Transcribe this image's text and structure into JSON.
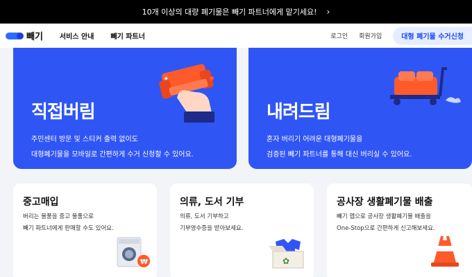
{
  "promo": {
    "text": "10개 이상의 대량 폐기물은 빼기 파트너에게 맡기세요!",
    "chevron": "›"
  },
  "header": {
    "logo_text": "빼기",
    "nav": [
      "서비스 안내",
      "빼기 파트너"
    ],
    "login": "로그인",
    "signup": "회원가입",
    "cta": "대형 폐기물 수거신청"
  },
  "cards": {
    "direct": {
      "title": "직접버림",
      "desc": [
        "주민센터 방문 및 스티커 출력 없이도",
        "대형폐기물을 모바일로 간편하게 수거 신청할 수 있어요."
      ]
    },
    "pickup": {
      "title": "내려드림",
      "desc": [
        "혼자 버리기 어려운 대형폐기물을",
        "검증된 빼기 파트너를 통해 대신 버리실 수 있어요."
      ]
    },
    "used": {
      "title": "중고매입",
      "desc": [
        "버리는 물품을 중고 물품으로",
        "빼기 파트너에게 판매할 수도 있어요."
      ]
    },
    "donate": {
      "title": "의류, 도서 기부",
      "desc": [
        "의류, 도서 기부하고",
        "기부영수증을 받아보세요."
      ]
    },
    "construction": {
      "title": "공사장 생활폐기물 배출",
      "desc": [
        "빼기 앱으로 공사장 생활폐기물 배출을",
        "One-Stop으로 간편하게 신고해보세요."
      ]
    }
  },
  "colors": {
    "primary": "#2f56f5",
    "accent": "#1b49ff",
    "sofa": "#ff5a2c"
  }
}
